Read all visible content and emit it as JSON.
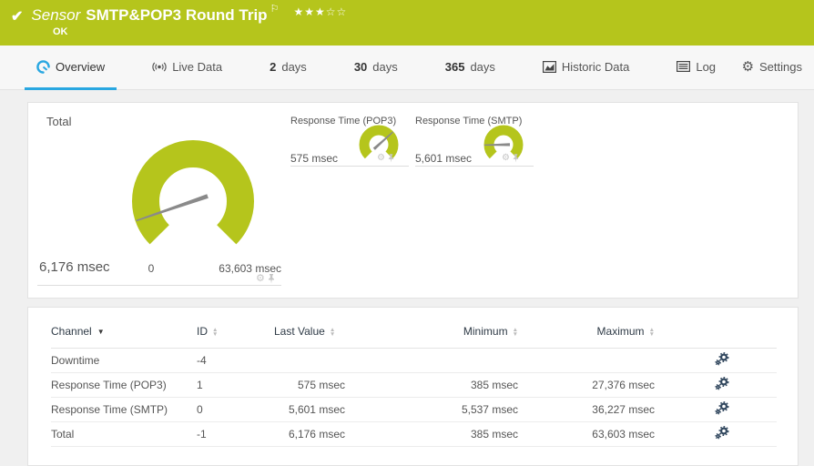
{
  "colors": {
    "brand_green": "#b5c51c",
    "accent_blue": "#29a7e1",
    "needle_gray": "#8a8a8a"
  },
  "header": {
    "check_icon": "✔",
    "kind_label": "Sensor",
    "title": "SMTP&POP3 Round Trip",
    "flag_icon": "⚐",
    "stars_filled": "★★★",
    "stars_empty": "☆☆",
    "status": "OK"
  },
  "tabs": [
    {
      "prefix": "",
      "label": "Overview",
      "icon": "gauge-icon"
    },
    {
      "prefix": "",
      "label": "Live Data",
      "icon": "broadcast-icon"
    },
    {
      "prefix": "2",
      "label": "days",
      "icon": ""
    },
    {
      "prefix": "30",
      "label": "days",
      "icon": ""
    },
    {
      "prefix": "365",
      "label": "days",
      "icon": ""
    },
    {
      "prefix": "",
      "label": "Historic Data",
      "icon": "area-chart-icon"
    },
    {
      "prefix": "",
      "label": "Log",
      "icon": "log-icon"
    },
    {
      "prefix": "",
      "label": "Settings",
      "icon": "gear-icon"
    }
  ],
  "icons": {
    "gear": "⚙"
  },
  "chart_data": [
    {
      "type": "gauge",
      "title": "Total",
      "value": 6176,
      "unit": "msec",
      "value_label": "6,176 msec",
      "min": 0,
      "min_label": "0",
      "max": 63603,
      "max_label": "63,603 msec",
      "needle_angle_deg": -109
    },
    {
      "type": "gauge",
      "title": "Response Time (POP3)",
      "value": 575,
      "unit": "msec",
      "value_label": "575 msec",
      "needle_angle_deg": 48
    },
    {
      "type": "gauge",
      "title": "Response Time (SMTP)",
      "value": 5601,
      "unit": "msec",
      "value_label": "5,601 msec",
      "needle_angle_deg": -91
    }
  ],
  "table": {
    "columns": [
      {
        "label": "Channel",
        "sort": "active"
      },
      {
        "label": "ID",
        "sort": "both"
      },
      {
        "label": "Last Value",
        "sort": "both"
      },
      {
        "label": "Minimum",
        "sort": "both"
      },
      {
        "label": "Maximum",
        "sort": "both"
      }
    ],
    "rows": [
      {
        "channel": "Downtime",
        "id": "-4",
        "last": "",
        "min": "",
        "max": ""
      },
      {
        "channel": "Response Time (POP3)",
        "id": "1",
        "last": "575 msec",
        "min": "385 msec",
        "max": "27,376 msec"
      },
      {
        "channel": "Response Time (SMTP)",
        "id": "0",
        "last": "5,601 msec",
        "min": "5,537 msec",
        "max": "36,227 msec"
      },
      {
        "channel": "Total",
        "id": "-1",
        "last": "6,176 msec",
        "min": "385 msec",
        "max": "63,603 msec"
      }
    ]
  }
}
